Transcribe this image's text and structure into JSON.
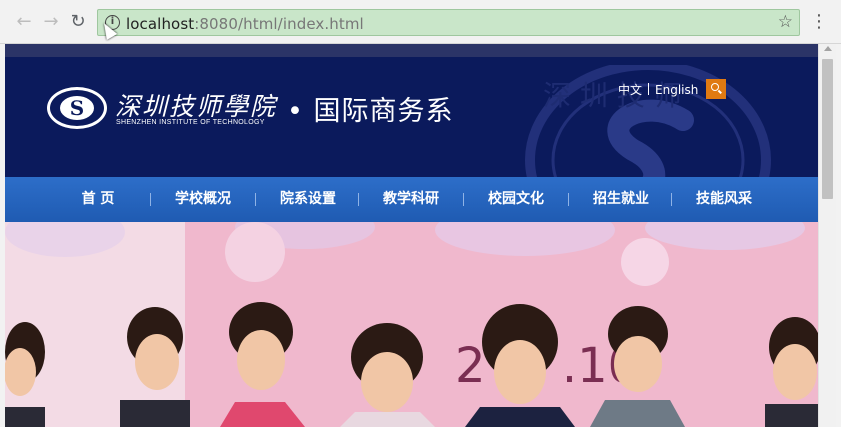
{
  "browser": {
    "url_host": "localhost",
    "url_rest": ":8080/html/index.html",
    "back_icon": "arrow-left-icon",
    "forward_icon": "arrow-right-icon",
    "reload_icon": "reload-icon",
    "bookmark_icon": "star-icon",
    "menu_icon": "more-vertical-icon"
  },
  "site": {
    "school_name_cn": "深圳技师學院",
    "school_name_en": "SHENZHEN INSTITUTE OF TECHNOLOGY",
    "dept_name": "• 国际商务系",
    "seal_letter": "S",
    "lang": {
      "cn": "中文",
      "en": "English"
    },
    "search_icon": "search-icon"
  },
  "nav": {
    "items": [
      {
        "label": "首 页"
      },
      {
        "label": "学校概况"
      },
      {
        "label": "院系设置"
      },
      {
        "label": "教学科研"
      },
      {
        "label": "校园文化"
      },
      {
        "label": "招生就业"
      },
      {
        "label": "技能风采"
      }
    ]
  },
  "banner": {
    "date_text": "2  6.  .10"
  },
  "colors": {
    "header_bg": "#0b1a5c",
    "nav_bg": "#2d6ec9",
    "search_accent": "#e07a12",
    "url_bar_bg": "#c9e6c9"
  }
}
